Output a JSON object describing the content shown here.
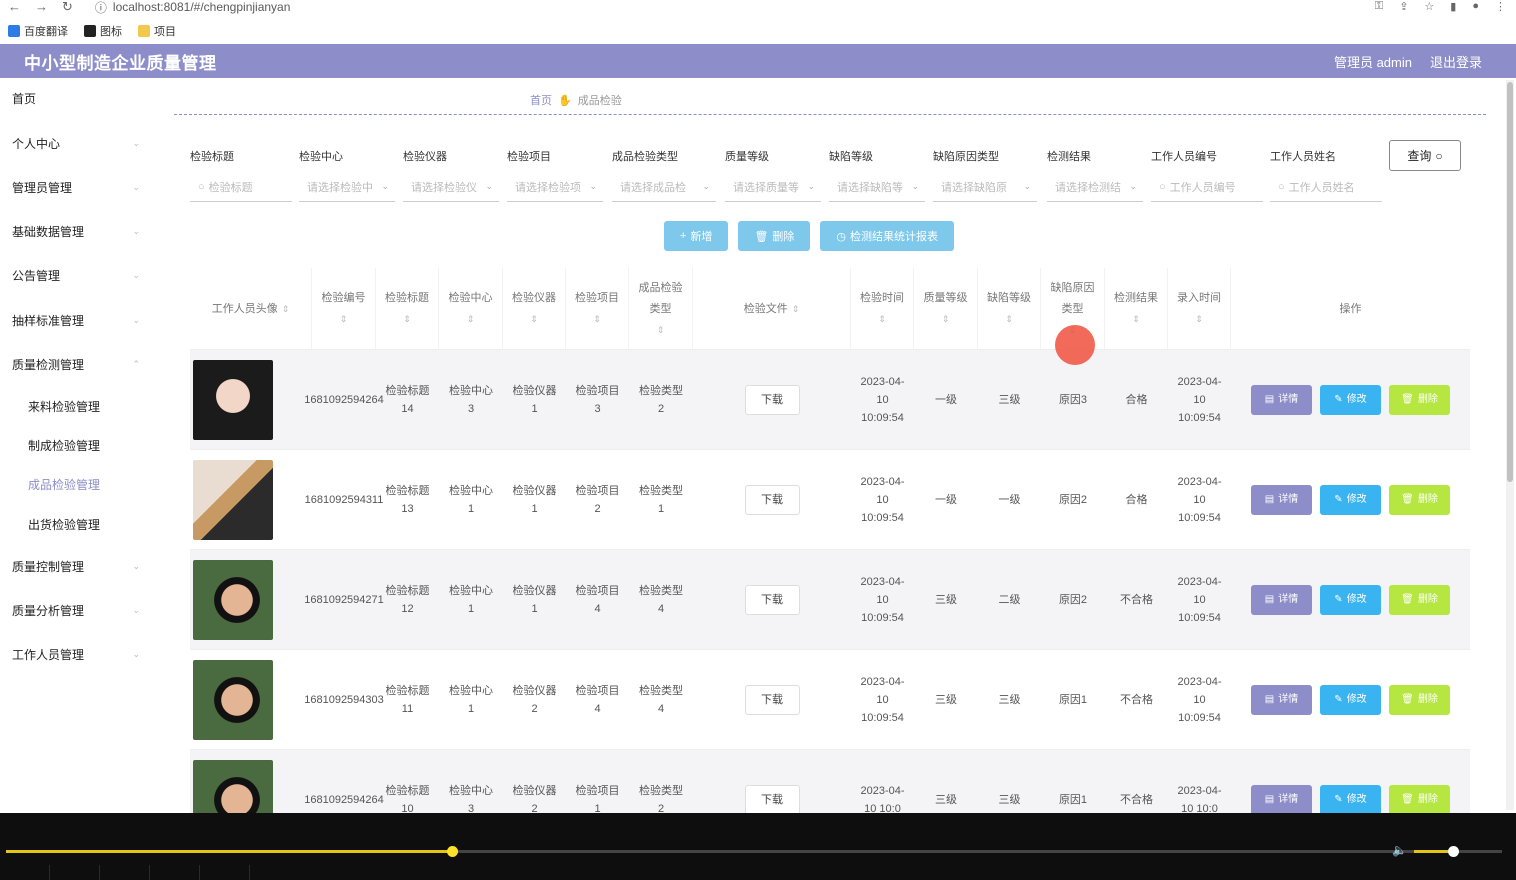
{
  "browser": {
    "url": "localhost:8081/#/chengpinjianyan",
    "bookmarks": [
      "百度翻译",
      "图标",
      "项目"
    ]
  },
  "header": {
    "title": "中小型制造企业质量管理",
    "user": "管理员 admin",
    "logout": "退出登录"
  },
  "sidebar": {
    "items": [
      {
        "label": "首页"
      },
      {
        "label": "个人中心"
      },
      {
        "label": "管理员管理"
      },
      {
        "label": "基础数据管理"
      },
      {
        "label": "公告管理"
      },
      {
        "label": "抽样标准管理"
      },
      {
        "label": "质量检测管理"
      },
      {
        "label": "质量控制管理"
      },
      {
        "label": "质量分析管理"
      },
      {
        "label": "工作人员管理"
      }
    ],
    "sub": [
      "来料检验管理",
      "制成检验管理",
      "成品检验管理",
      "出货检验管理"
    ]
  },
  "breadcrumb": {
    "home": "首页",
    "current": "成品检验"
  },
  "filters": [
    {
      "label": "检验标题",
      "placeholder": "检验标题"
    },
    {
      "label": "检验中心",
      "placeholder": "请选择检验中"
    },
    {
      "label": "检验仪器",
      "placeholder": "请选择检验仪"
    },
    {
      "label": "检验项目",
      "placeholder": "请选择检验项"
    },
    {
      "label": "成品检验类型",
      "placeholder": "请选择成品检"
    },
    {
      "label": "质量等级",
      "placeholder": "请选择质量等"
    },
    {
      "label": "缺陷等级",
      "placeholder": "请选择缺陷等"
    },
    {
      "label": "缺陷原因类型",
      "placeholder": "请选择缺陷原"
    },
    {
      "label": "检测结果",
      "placeholder": "请选择检测结"
    },
    {
      "label": "工作人员编号",
      "placeholder": "工作人员编号"
    },
    {
      "label": "工作人员姓名",
      "placeholder": "工作人员姓名"
    }
  ],
  "query_label": "查询",
  "actions": {
    "add": "新增",
    "delete": "删除",
    "report": "检测结果统计报表"
  },
  "table": {
    "headers": [
      "工作人员头像",
      "检验编号",
      "检验标题",
      "检验中心",
      "检验仪器",
      "检验项目",
      "成品检验类型",
      "检验文件",
      "检验时间",
      "质量等级",
      "缺陷等级",
      "缺陷原因类型",
      "检测结果",
      "录入时间",
      "操作"
    ],
    "download_label": "下载",
    "op_labels": {
      "detail": "详情",
      "edit": "修改",
      "delete": "删除"
    },
    "rows": [
      {
        "no": "1681092594264",
        "title": "检验标题14",
        "center": "检验中心3",
        "instr": "检验仪器1",
        "item": "检验项目3",
        "type": "检验类型2",
        "time": "2023-04-10 10:09:54",
        "quality": "一级",
        "defect": "三级",
        "reason": "原因3",
        "result": "合格",
        "entry": "2023-04-10 10:09:54"
      },
      {
        "no": "1681092594311",
        "title": "检验标题13",
        "center": "检验中心1",
        "instr": "检验仪器1",
        "item": "检验项目2",
        "type": "检验类型1",
        "time": "2023-04-10 10:09:54",
        "quality": "一级",
        "defect": "一级",
        "reason": "原因2",
        "result": "合格",
        "entry": "2023-04-10 10:09:54"
      },
      {
        "no": "1681092594271",
        "title": "检验标题12",
        "center": "检验中心1",
        "instr": "检验仪器1",
        "item": "检验项目4",
        "type": "检验类型4",
        "time": "2023-04-10 10:09:54",
        "quality": "三级",
        "defect": "二级",
        "reason": "原因2",
        "result": "不合格",
        "entry": "2023-04-10 10:09:54"
      },
      {
        "no": "1681092594303",
        "title": "检验标题11",
        "center": "检验中心1",
        "instr": "检验仪器2",
        "item": "检验项目4",
        "type": "检验类型4",
        "time": "2023-04-10 10:09:54",
        "quality": "三级",
        "defect": "三级",
        "reason": "原因1",
        "result": "不合格",
        "entry": "2023-04-10 10:09:54"
      },
      {
        "no": "1681092594264",
        "title": "检验标题10",
        "center": "检验中心3",
        "instr": "检验仪器2",
        "item": "检验项目1",
        "type": "检验类型2",
        "time": "2023-04-10 10:0",
        "quality": "三级",
        "defect": "三级",
        "reason": "原因1",
        "result": "不合格",
        "entry": "2023-04-10 10:0"
      }
    ]
  },
  "colors": {
    "primary": "#8c8dc9",
    "edit": "#3ab4f0",
    "delete": "#b6e640",
    "action": "#7ec8ec"
  }
}
